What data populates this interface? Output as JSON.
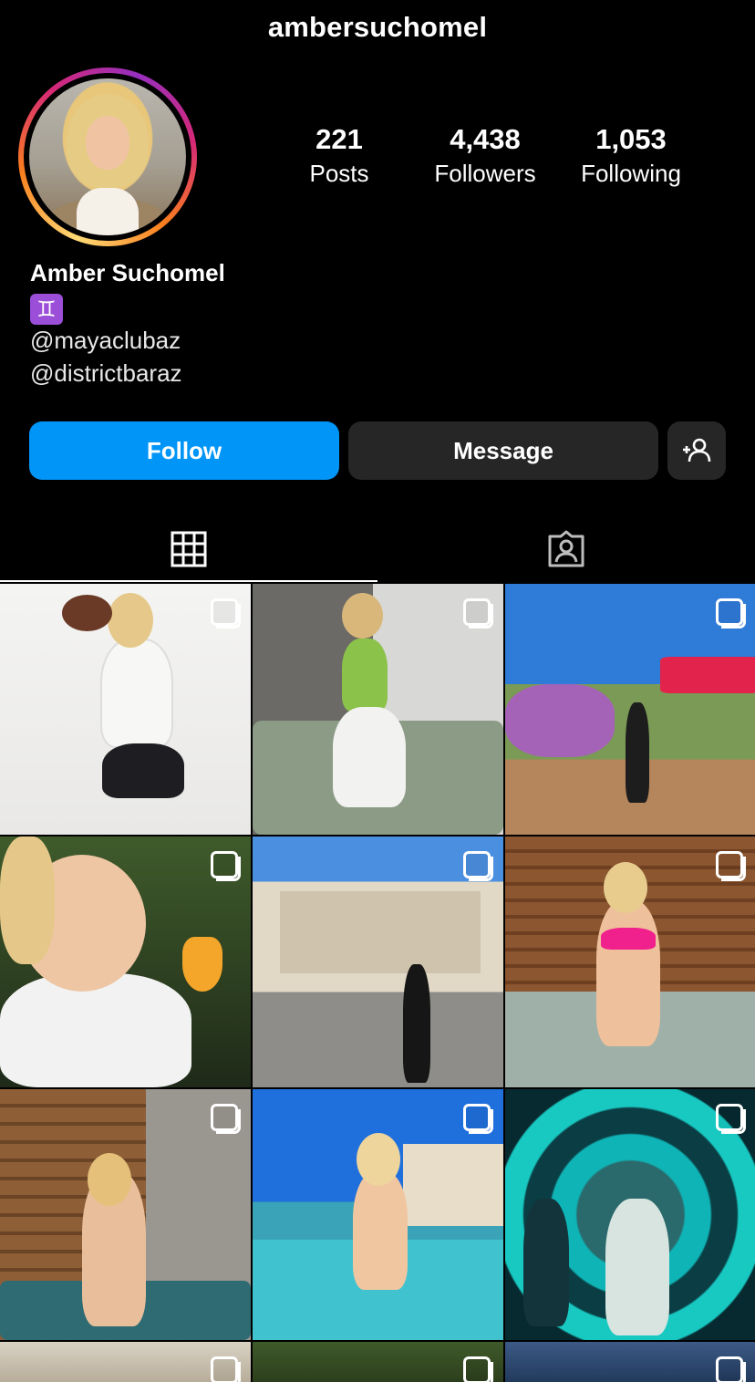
{
  "profile": {
    "username": "ambersuchomel",
    "display_name": "Amber Suchomel",
    "zodiac_symbol": "♊",
    "links": [
      "@mayaclubaz",
      "@districtbaraz"
    ]
  },
  "stats": {
    "posts": {
      "value": "221",
      "label": "Posts"
    },
    "followers": {
      "value": "4,438",
      "label": "Followers"
    },
    "following": {
      "value": "1,053",
      "label": "Following"
    }
  },
  "actions": {
    "follow_label": "Follow",
    "message_label": "Message",
    "add_icon": "add-person-icon"
  },
  "tabs": [
    {
      "icon": "grid-icon",
      "active": true
    },
    {
      "icon": "tagged-icon",
      "active": false
    }
  ],
  "posts_grid": {
    "icon": "carousel-icon",
    "colors": {
      "accent": "#0095f6",
      "button_dark": "#262626",
      "background": "#000000"
    }
  }
}
